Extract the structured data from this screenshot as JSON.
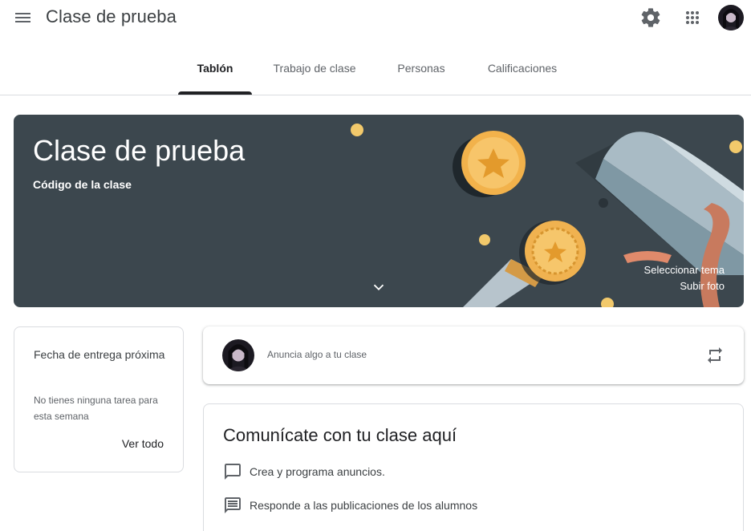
{
  "header": {
    "title": "Clase de prueba",
    "menu_icon": "hamburger-menu-icon",
    "settings_icon": "gear-icon",
    "apps_icon": "apps-grid-icon"
  },
  "tabs": [
    {
      "label": "Tablón",
      "active": true
    },
    {
      "label": "Trabajo de clase",
      "active": false
    },
    {
      "label": "Personas",
      "active": false
    },
    {
      "label": "Calificaciones",
      "active": false
    }
  ],
  "banner": {
    "title": "Clase de prueba",
    "code_label": "Código de la clase",
    "select_theme": "Seleccionar tema",
    "upload_photo": "Subir foto",
    "background_color": "#3c474e"
  },
  "upcoming": {
    "title": "Fecha de entrega próxima",
    "text": "No tienes ninguna tarea para esta semana",
    "link": "Ver todo"
  },
  "announce": {
    "placeholder": "Anuncia algo a tu clase"
  },
  "communicate": {
    "title": "Comunícate con tu clase aquí",
    "items": [
      {
        "icon": "comment-icon",
        "label": "Crea y programa anuncios."
      },
      {
        "icon": "message-list-icon",
        "label": "Responde a las publicaciones de los alumnos"
      }
    ]
  }
}
